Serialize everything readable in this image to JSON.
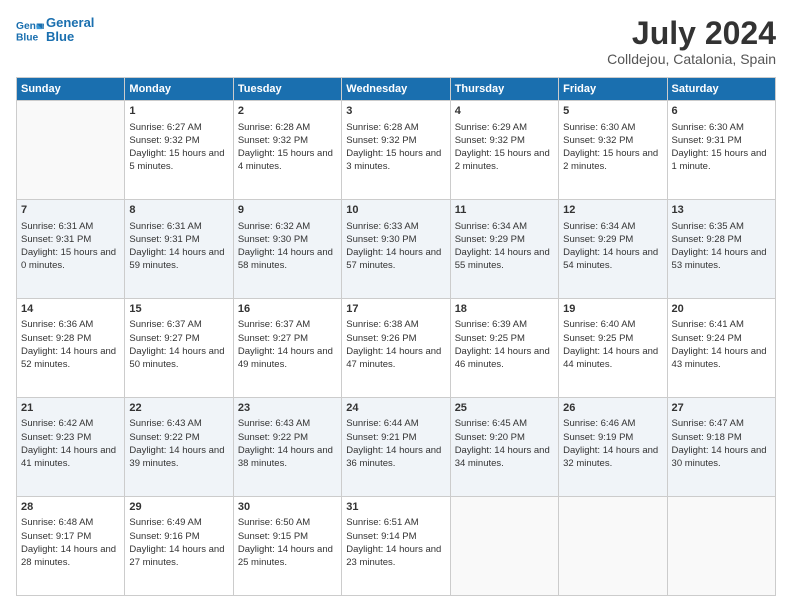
{
  "header": {
    "logo_line1": "General",
    "logo_line2": "Blue",
    "month_year": "July 2024",
    "location": "Colldejou, Catalonia, Spain"
  },
  "days_of_week": [
    "Sunday",
    "Monday",
    "Tuesday",
    "Wednesday",
    "Thursday",
    "Friday",
    "Saturday"
  ],
  "weeks": [
    [
      {
        "num": "",
        "sunrise": "",
        "sunset": "",
        "daylight": "",
        "empty": true
      },
      {
        "num": "1",
        "sunrise": "Sunrise: 6:27 AM",
        "sunset": "Sunset: 9:32 PM",
        "daylight": "Daylight: 15 hours and 5 minutes."
      },
      {
        "num": "2",
        "sunrise": "Sunrise: 6:28 AM",
        "sunset": "Sunset: 9:32 PM",
        "daylight": "Daylight: 15 hours and 4 minutes."
      },
      {
        "num": "3",
        "sunrise": "Sunrise: 6:28 AM",
        "sunset": "Sunset: 9:32 PM",
        "daylight": "Daylight: 15 hours and 3 minutes."
      },
      {
        "num": "4",
        "sunrise": "Sunrise: 6:29 AM",
        "sunset": "Sunset: 9:32 PM",
        "daylight": "Daylight: 15 hours and 2 minutes."
      },
      {
        "num": "5",
        "sunrise": "Sunrise: 6:30 AM",
        "sunset": "Sunset: 9:32 PM",
        "daylight": "Daylight: 15 hours and 2 minutes."
      },
      {
        "num": "6",
        "sunrise": "Sunrise: 6:30 AM",
        "sunset": "Sunset: 9:31 PM",
        "daylight": "Daylight: 15 hours and 1 minute."
      }
    ],
    [
      {
        "num": "7",
        "sunrise": "Sunrise: 6:31 AM",
        "sunset": "Sunset: 9:31 PM",
        "daylight": "Daylight: 15 hours and 0 minutes."
      },
      {
        "num": "8",
        "sunrise": "Sunrise: 6:31 AM",
        "sunset": "Sunset: 9:31 PM",
        "daylight": "Daylight: 14 hours and 59 minutes."
      },
      {
        "num": "9",
        "sunrise": "Sunrise: 6:32 AM",
        "sunset": "Sunset: 9:30 PM",
        "daylight": "Daylight: 14 hours and 58 minutes."
      },
      {
        "num": "10",
        "sunrise": "Sunrise: 6:33 AM",
        "sunset": "Sunset: 9:30 PM",
        "daylight": "Daylight: 14 hours and 57 minutes."
      },
      {
        "num": "11",
        "sunrise": "Sunrise: 6:34 AM",
        "sunset": "Sunset: 9:29 PM",
        "daylight": "Daylight: 14 hours and 55 minutes."
      },
      {
        "num": "12",
        "sunrise": "Sunrise: 6:34 AM",
        "sunset": "Sunset: 9:29 PM",
        "daylight": "Daylight: 14 hours and 54 minutes."
      },
      {
        "num": "13",
        "sunrise": "Sunrise: 6:35 AM",
        "sunset": "Sunset: 9:28 PM",
        "daylight": "Daylight: 14 hours and 53 minutes."
      }
    ],
    [
      {
        "num": "14",
        "sunrise": "Sunrise: 6:36 AM",
        "sunset": "Sunset: 9:28 PM",
        "daylight": "Daylight: 14 hours and 52 minutes."
      },
      {
        "num": "15",
        "sunrise": "Sunrise: 6:37 AM",
        "sunset": "Sunset: 9:27 PM",
        "daylight": "Daylight: 14 hours and 50 minutes."
      },
      {
        "num": "16",
        "sunrise": "Sunrise: 6:37 AM",
        "sunset": "Sunset: 9:27 PM",
        "daylight": "Daylight: 14 hours and 49 minutes."
      },
      {
        "num": "17",
        "sunrise": "Sunrise: 6:38 AM",
        "sunset": "Sunset: 9:26 PM",
        "daylight": "Daylight: 14 hours and 47 minutes."
      },
      {
        "num": "18",
        "sunrise": "Sunrise: 6:39 AM",
        "sunset": "Sunset: 9:25 PM",
        "daylight": "Daylight: 14 hours and 46 minutes."
      },
      {
        "num": "19",
        "sunrise": "Sunrise: 6:40 AM",
        "sunset": "Sunset: 9:25 PM",
        "daylight": "Daylight: 14 hours and 44 minutes."
      },
      {
        "num": "20",
        "sunrise": "Sunrise: 6:41 AM",
        "sunset": "Sunset: 9:24 PM",
        "daylight": "Daylight: 14 hours and 43 minutes."
      }
    ],
    [
      {
        "num": "21",
        "sunrise": "Sunrise: 6:42 AM",
        "sunset": "Sunset: 9:23 PM",
        "daylight": "Daylight: 14 hours and 41 minutes."
      },
      {
        "num": "22",
        "sunrise": "Sunrise: 6:43 AM",
        "sunset": "Sunset: 9:22 PM",
        "daylight": "Daylight: 14 hours and 39 minutes."
      },
      {
        "num": "23",
        "sunrise": "Sunrise: 6:43 AM",
        "sunset": "Sunset: 9:22 PM",
        "daylight": "Daylight: 14 hours and 38 minutes."
      },
      {
        "num": "24",
        "sunrise": "Sunrise: 6:44 AM",
        "sunset": "Sunset: 9:21 PM",
        "daylight": "Daylight: 14 hours and 36 minutes."
      },
      {
        "num": "25",
        "sunrise": "Sunrise: 6:45 AM",
        "sunset": "Sunset: 9:20 PM",
        "daylight": "Daylight: 14 hours and 34 minutes."
      },
      {
        "num": "26",
        "sunrise": "Sunrise: 6:46 AM",
        "sunset": "Sunset: 9:19 PM",
        "daylight": "Daylight: 14 hours and 32 minutes."
      },
      {
        "num": "27",
        "sunrise": "Sunrise: 6:47 AM",
        "sunset": "Sunset: 9:18 PM",
        "daylight": "Daylight: 14 hours and 30 minutes."
      }
    ],
    [
      {
        "num": "28",
        "sunrise": "Sunrise: 6:48 AM",
        "sunset": "Sunset: 9:17 PM",
        "daylight": "Daylight: 14 hours and 28 minutes."
      },
      {
        "num": "29",
        "sunrise": "Sunrise: 6:49 AM",
        "sunset": "Sunset: 9:16 PM",
        "daylight": "Daylight: 14 hours and 27 minutes."
      },
      {
        "num": "30",
        "sunrise": "Sunrise: 6:50 AM",
        "sunset": "Sunset: 9:15 PM",
        "daylight": "Daylight: 14 hours and 25 minutes."
      },
      {
        "num": "31",
        "sunrise": "Sunrise: 6:51 AM",
        "sunset": "Sunset: 9:14 PM",
        "daylight": "Daylight: 14 hours and 23 minutes."
      },
      {
        "num": "",
        "sunrise": "",
        "sunset": "",
        "daylight": "",
        "empty": true
      },
      {
        "num": "",
        "sunrise": "",
        "sunset": "",
        "daylight": "",
        "empty": true
      },
      {
        "num": "",
        "sunrise": "",
        "sunset": "",
        "daylight": "",
        "empty": true
      }
    ]
  ]
}
